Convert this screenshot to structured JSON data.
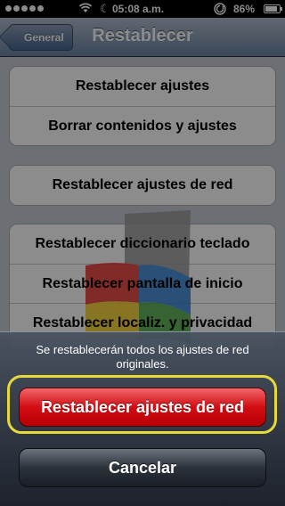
{
  "status_bar": {
    "time": "05:08 a.m.",
    "battery": "86%",
    "battery_level": 0.86
  },
  "nav": {
    "back_label": "General",
    "title": "Restablecer"
  },
  "groups": [
    {
      "items": [
        "Restablecer ajustes",
        "Borrar contenidos y ajustes"
      ]
    },
    {
      "items": [
        "Restablecer ajustes de red"
      ]
    },
    {
      "items": [
        "Restablecer diccionario teclado",
        "Restablecer pantalla de inicio",
        "Restablecer localiz. y privacidad"
      ]
    }
  ],
  "action_sheet": {
    "message": "Se restablecerán todos los ajustes de red originales.",
    "destructive_label": "Restablecer ajustes de red",
    "cancel_label": "Cancelar"
  },
  "colors": {
    "highlight": "#e6d93a",
    "destructive": "#d20d13",
    "nav_bar": "#6d84a2"
  },
  "icons": [
    "wifi-icon",
    "moon-icon",
    "lock-icon",
    "battery-icon",
    "signal-dots-icon"
  ]
}
